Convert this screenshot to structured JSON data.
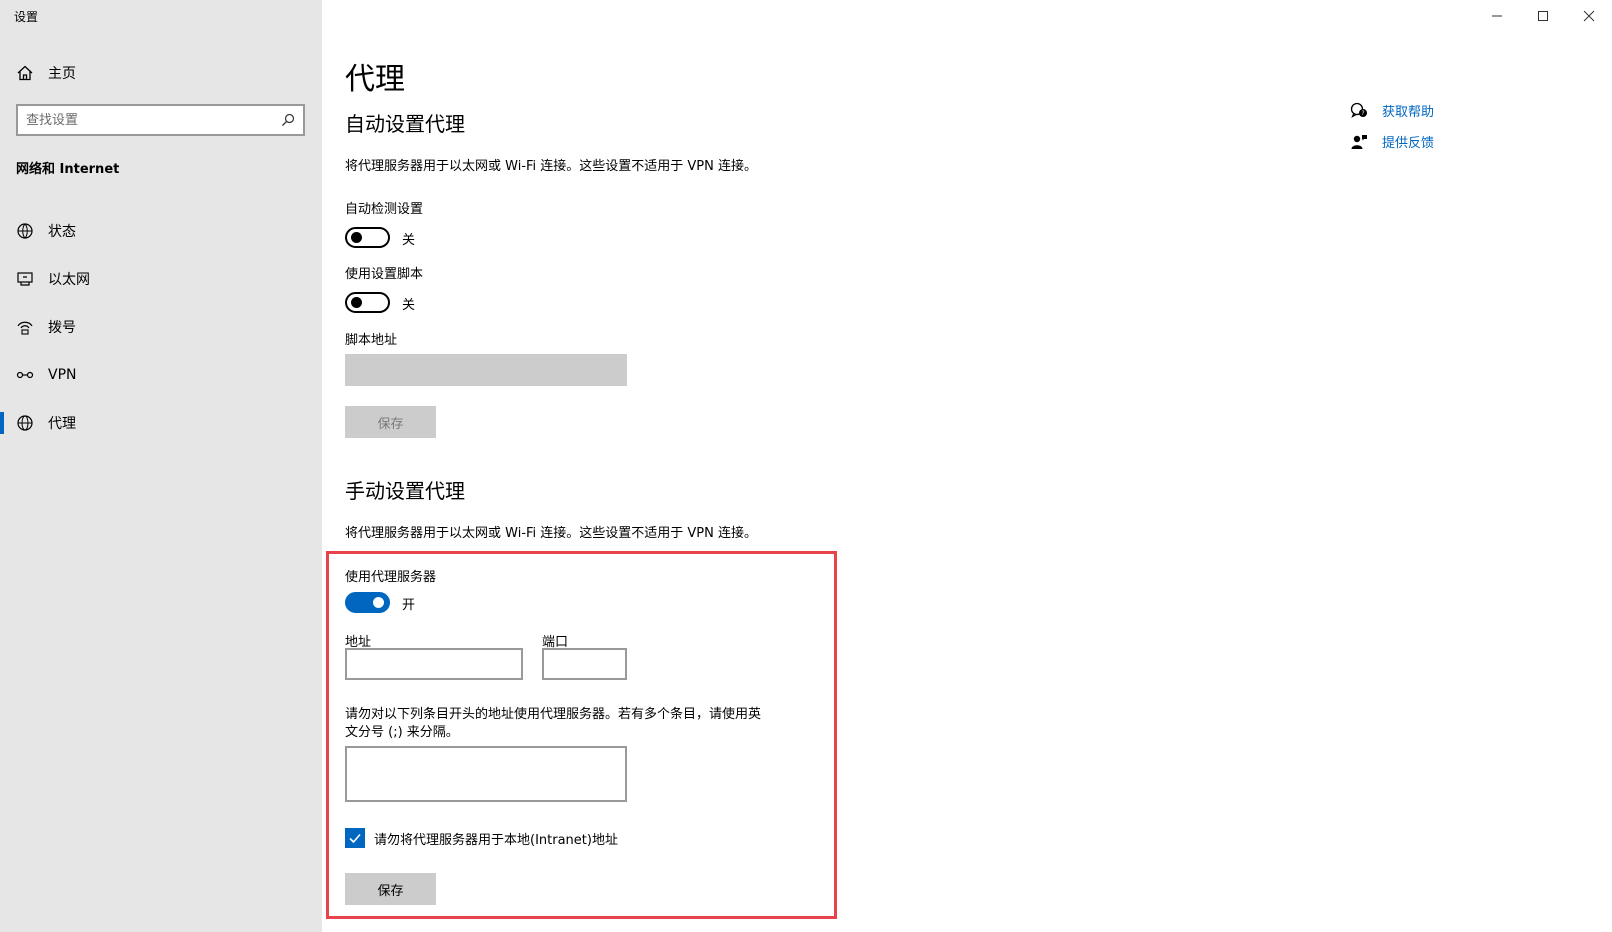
{
  "window": {
    "title": "设置"
  },
  "sidebar": {
    "home_label": "主页",
    "search_placeholder": "查找设置",
    "section_label": "网络和 Internet",
    "items": [
      {
        "label": "状态",
        "icon": "status-icon"
      },
      {
        "label": "以太网",
        "icon": "ethernet-icon"
      },
      {
        "label": "拨号",
        "icon": "dialup-icon"
      },
      {
        "label": "VPN",
        "icon": "vpn-icon"
      },
      {
        "label": "代理",
        "icon": "globe-icon",
        "active": true
      }
    ]
  },
  "page": {
    "title": "代理"
  },
  "auto": {
    "title": "自动设置代理",
    "description": "将代理服务器用于以太网或 Wi-Fi 连接。这些设置不适用于 VPN 连接。",
    "detect_label": "自动检测设置",
    "detect_state": "关",
    "script_label": "使用设置脚本",
    "script_state": "关",
    "address_label": "脚本地址",
    "save_label": "保存"
  },
  "manual": {
    "title": "手动设置代理",
    "description": "将代理服务器用于以太网或 Wi-Fi 连接。这些设置不适用于 VPN 连接。",
    "use_proxy_label": "使用代理服务器",
    "use_proxy_state": "开",
    "address_label": "地址",
    "port_label": "端口",
    "exceptions_label_line1": "请勿对以下列条目开头的地址使用代理服务器。若有多个条目，请使用英",
    "exceptions_label_line2": "文分号 (;) 来分隔。",
    "local_label": "请勿将代理服务器用于本地(Intranet)地址",
    "save_label": "保存"
  },
  "help": {
    "get_help": "获取帮助",
    "feedback": "提供反馈"
  },
  "colors": {
    "accent": "#0067c0",
    "highlight": "#e8434b",
    "sidebar_bg": "#e6e6e6"
  }
}
